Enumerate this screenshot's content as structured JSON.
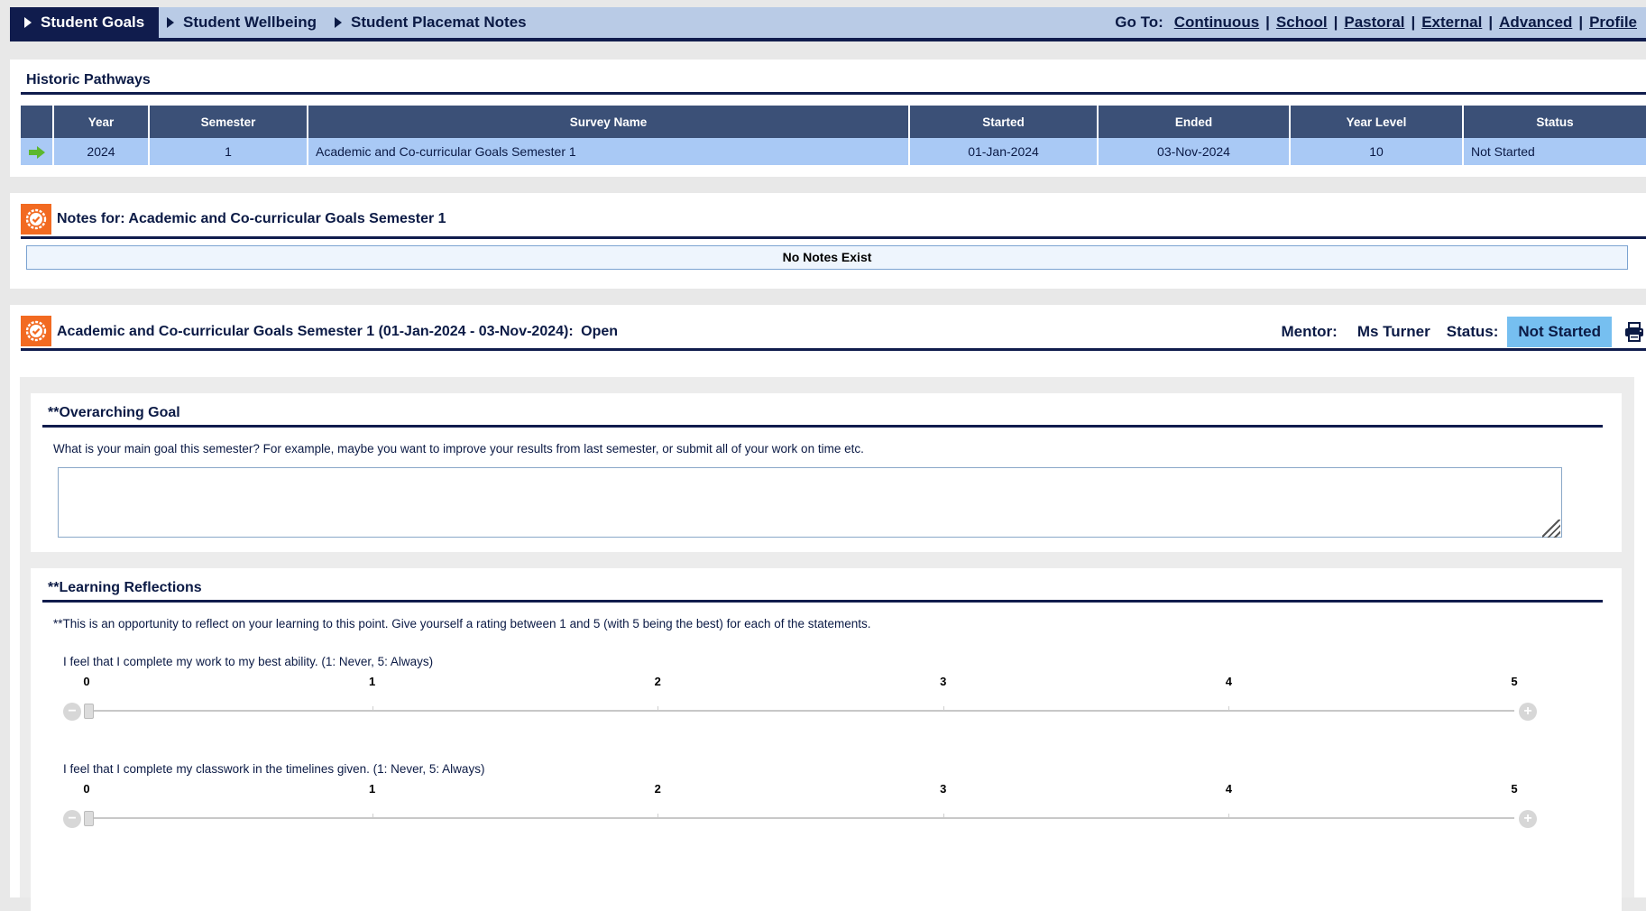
{
  "tabs": [
    {
      "label": "Student Goals",
      "active": true
    },
    {
      "label": "Student Wellbeing",
      "active": false
    },
    {
      "label": "Student Placemat Notes",
      "active": false
    }
  ],
  "goto": {
    "label": "Go To:",
    "links": [
      "Continuous",
      "School",
      "Pastoral",
      "External",
      "Advanced",
      "Profile"
    ]
  },
  "historic": {
    "title": "Historic Pathways",
    "columns": [
      "",
      "Year",
      "Semester",
      "Survey Name",
      "Started",
      "Ended",
      "Year Level",
      "Status"
    ],
    "rows": [
      {
        "year": "2024",
        "semester": "1",
        "survey_name": "Academic and Co-curricular Goals Semester 1",
        "started": "01-Jan-2024",
        "ended": "03-Nov-2024",
        "year_level": "10",
        "status": "Not Started"
      }
    ]
  },
  "notes": {
    "title": "Notes for: Academic and Co-curricular Goals Semester 1",
    "empty_text": "No Notes Exist"
  },
  "survey": {
    "title": "Academic and Co-curricular Goals Semester 1 (01-Jan-2024 - 03-Nov-2024):",
    "state": "Open",
    "mentor_label": "Mentor:",
    "mentor": "Ms Turner",
    "status_label": "Status:",
    "status": "Not Started"
  },
  "overarching": {
    "title": "**Overarching Goal",
    "description": "What is your main goal this semester? For example, maybe you want to improve your results from last semester, or submit all of your work on time etc.",
    "value": ""
  },
  "reflections": {
    "title": "**Learning Reflections",
    "description": "**This is an opportunity to reflect on your learning to this point. Give yourself a rating between 1 and 5 (with 5 being the best) for each of the statements.",
    "scale": [
      "0",
      "1",
      "2",
      "3",
      "4",
      "5"
    ],
    "items": [
      {
        "statement": "I feel that I complete my work to my best ability. (1: Never, 5: Always)",
        "value": 0
      },
      {
        "statement": "I feel that I complete my classwork in the timelines given. (1: Never, 5: Always)",
        "value": 0
      }
    ]
  },
  "colors": {
    "navy": "#101c4d",
    "header_blue": "#3b5077",
    "row_blue": "#a9c9f5",
    "status_blue": "#76bff0",
    "badge_orange": "#f26a21",
    "arrow_green": "#5cb82e"
  }
}
